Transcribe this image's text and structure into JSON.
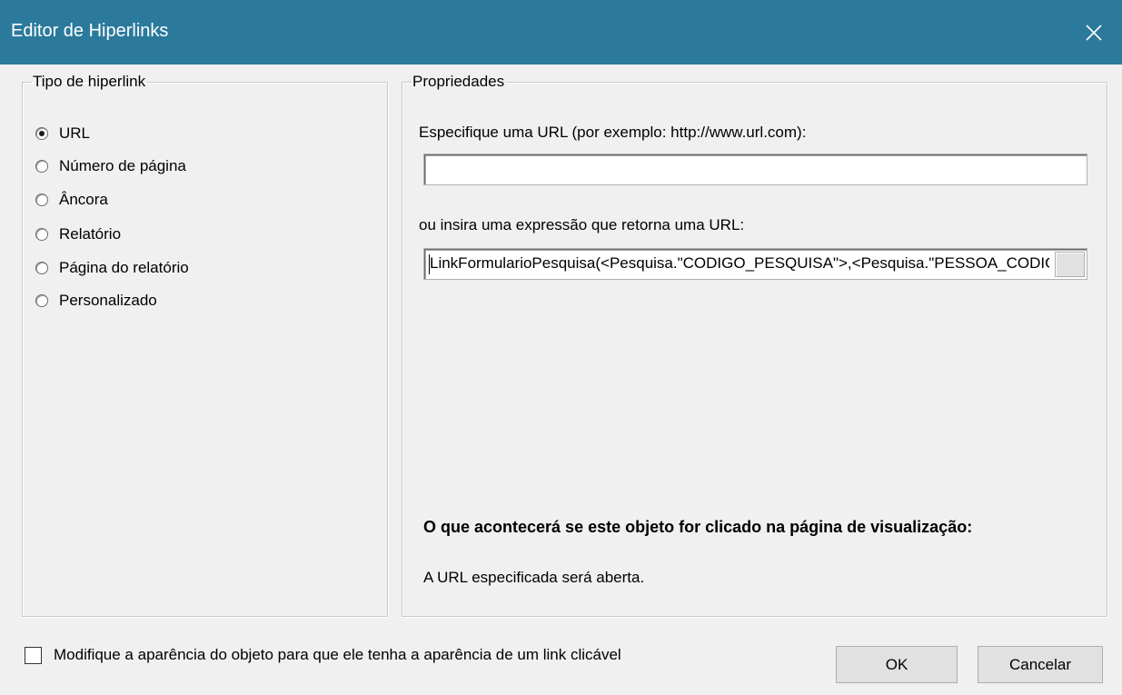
{
  "window": {
    "title": "Editor de Hiperlinks",
    "close_icon": "close-icon"
  },
  "left_group": {
    "legend": "Tipo de hiperlink",
    "options": [
      {
        "label": "URL",
        "selected": true
      },
      {
        "label": "Número de página",
        "selected": false
      },
      {
        "label": "Âncora",
        "selected": false
      },
      {
        "label": "Relatório",
        "selected": false
      },
      {
        "label": "Página do relatório",
        "selected": false
      },
      {
        "label": "Personalizado",
        "selected": false
      }
    ]
  },
  "right_group": {
    "legend": "Propriedades",
    "url_label": "Especifique uma URL (por exemplo: http://www.url.com):",
    "url_value": "",
    "expr_label": "ou insira uma expressão que retorna uma URL:",
    "expr_value": "LinkFormularioPesquisa(<Pesquisa.\"CODIGO_PESQUISA\">,<Pesquisa.\"PESSOA_CODIGO\">)",
    "info_heading": "O que acontecerá se este objeto for clicado na página de visualização:",
    "info_text": "A URL especificada será aberta."
  },
  "footer": {
    "checkbox_label": "Modifique a aparência do objeto para que ele tenha a aparência de um link clicável",
    "checkbox_checked": false,
    "ok_label": "OK",
    "cancel_label": "Cancelar"
  },
  "colors": {
    "titlebar": "#2b7a9c",
    "dialog_bg": "#f0f0f0"
  }
}
